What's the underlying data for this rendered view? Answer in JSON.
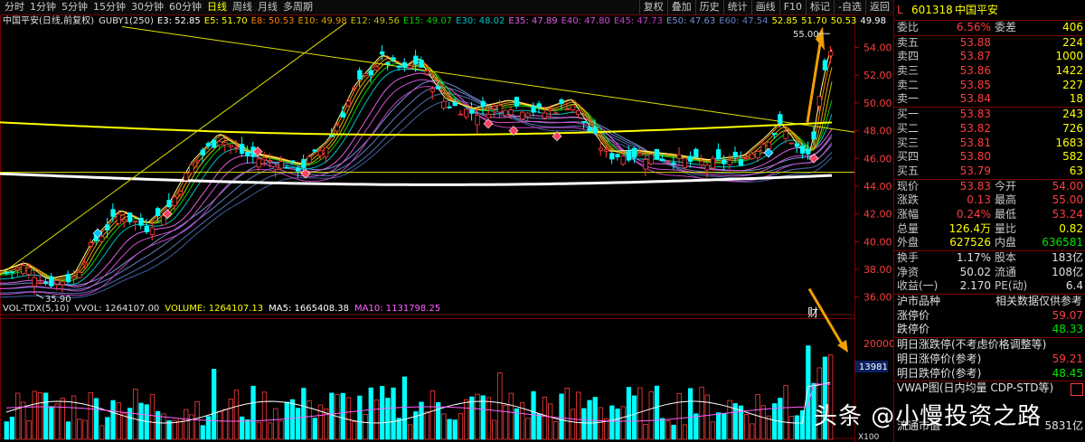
{
  "periods": [
    "分时",
    "1分钟",
    "5分钟",
    "15分钟",
    "30分钟",
    "60分钟",
    "日线",
    "周线",
    "月线",
    "多周期"
  ],
  "active_period": "日线",
  "toolbar": [
    "复权",
    "叠加",
    "历史",
    "统计",
    "画线",
    "F10",
    "标记",
    "-自选",
    "返回"
  ],
  "chart": {
    "title": "中国平安(日线,前复权)",
    "indicator_line": [
      "GUBY1(250)",
      "E3: 52.85",
      "E5: 51.70",
      "E8: 50.53",
      "E10: 49.98",
      "E12: 49.56",
      "E15: 49.07",
      "E30: 48.02",
      "E35: 47.89",
      "E40: 47.80",
      "E45: 47.73",
      "E50: 47.63",
      "E60: 47.54",
      "52.85",
      "51.70",
      "50.53",
      "49.98"
    ],
    "max_label": "55.00",
    "min_label": "35.90",
    "cai_label": "财",
    "price_ticks": [
      "54.00",
      "52.00",
      "50.00",
      "48.00",
      "46.00",
      "44.00",
      "42.00",
      "40.00",
      "38.00",
      "36.00"
    ],
    "vol_line": [
      "VOL-TDX(5,10)",
      "VVOL: 1264107.00",
      "VOLUME: 1264107.13",
      "MA5: 1665408.38",
      "MA10: 1131798.25"
    ],
    "vol_ticks": [
      "20000"
    ],
    "vol_bottom_label": "13981",
    "vol_unit": "X100",
    "colors": {
      "up": "#ff3c3c",
      "down": "#00ffff",
      "ma_yellow": "#ffff00",
      "ma_white": "#ffffff",
      "arrow": "#f0a000"
    }
  },
  "panel": {
    "code": "601318",
    "name": "中国平安",
    "weibi_label": "委比",
    "weibi": "6.56%",
    "weicha_label": "委差",
    "weicha": "406",
    "asks": [
      {
        "label": "卖五",
        "price": "53.88",
        "vol": "224"
      },
      {
        "label": "卖四",
        "price": "53.87",
        "vol": "1000"
      },
      {
        "label": "卖三",
        "price": "53.86",
        "vol": "1422"
      },
      {
        "label": "卖二",
        "price": "53.85",
        "vol": "227"
      },
      {
        "label": "卖一",
        "price": "53.84",
        "vol": "18"
      }
    ],
    "bids": [
      {
        "label": "买一",
        "price": "53.83",
        "vol": "243"
      },
      {
        "label": "买二",
        "price": "53.82",
        "vol": "726"
      },
      {
        "label": "买三",
        "price": "53.81",
        "vol": "1683"
      },
      {
        "label": "买四",
        "price": "53.80",
        "vol": "582"
      },
      {
        "label": "买五",
        "price": "53.79",
        "vol": "63"
      }
    ],
    "quote": [
      {
        "l1": "现价",
        "v1": "53.83",
        "l2": "今开",
        "v2": "54.00"
      },
      {
        "l1": "涨跌",
        "v1": "0.13",
        "l2": "最高",
        "v2": "55.00"
      },
      {
        "l1": "涨幅",
        "v1": "0.24%",
        "l2": "最低",
        "v2": "53.24"
      },
      {
        "l1": "总量",
        "v1": "126.4万",
        "l2": "量比",
        "v2": "0.82"
      },
      {
        "l1": "外盘",
        "v1": "627526",
        "l2": "内盘",
        "v2": "636581"
      }
    ],
    "stats": [
      {
        "l1": "换手",
        "v1": "1.17%",
        "l2": "股本",
        "v2": "183亿"
      },
      {
        "l1": "净资",
        "v1": "50.02",
        "l2": "流通",
        "v2": "108亿"
      },
      {
        "l1": "收益(一)",
        "v1": "2.170",
        "l2": "PE(动)",
        "v2": "6.4"
      }
    ],
    "market_label": "沪市品种",
    "related_label": "相关数据仅供参考",
    "limit_up_label": "涨停价",
    "limit_up": "59.07",
    "limit_down_label": "跌停价",
    "limit_down": "48.33",
    "tomorrow_note": "明日涨跌停(不考虑价格调整等)",
    "tomorrow_up_label": "明日涨停价(参考)",
    "tomorrow_up": "59.21",
    "tomorrow_down_label": "明日跌停价(参考)",
    "tomorrow_down": "48.45",
    "vwap_label": "VWAP图(日内均量 CDP-STD等)",
    "float_label": "流通市值",
    "float_value": "5831亿"
  },
  "watermark": "头条 @小慢投资之路"
}
